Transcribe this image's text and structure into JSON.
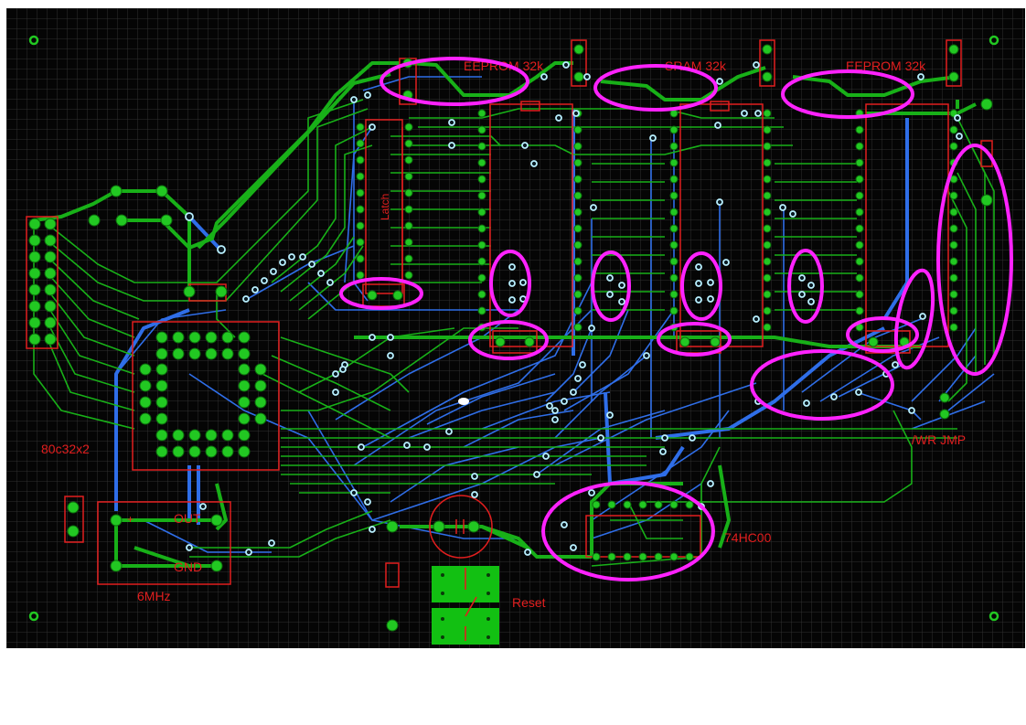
{
  "colors": {
    "board": "#050505",
    "grid": "#2e2e2e",
    "top_copper": "#18b018",
    "bottom_copper": "#2f6ee8",
    "silkscreen": "#e21e1e",
    "highlight": "#ff22ff",
    "via": "#b9f0ff",
    "pad": "#22c822"
  },
  "labels": {
    "eeprom_left": "EEPROM 32k",
    "sram": "SRAM 32k",
    "eeprom_right": "EEPROM 32k",
    "latch": "Latch",
    "mcu": "80c32x2",
    "crystal": "6MHz",
    "osc_out": "OUT",
    "osc_gnd": "GND",
    "reset": "Reset",
    "nand_gate": "74HC00",
    "wr_jumper": "/WR JMP"
  },
  "icons": {
    "reset_switch": "pushbutton-switch-icon",
    "mounting_hole": "mounting-hole-icon"
  }
}
